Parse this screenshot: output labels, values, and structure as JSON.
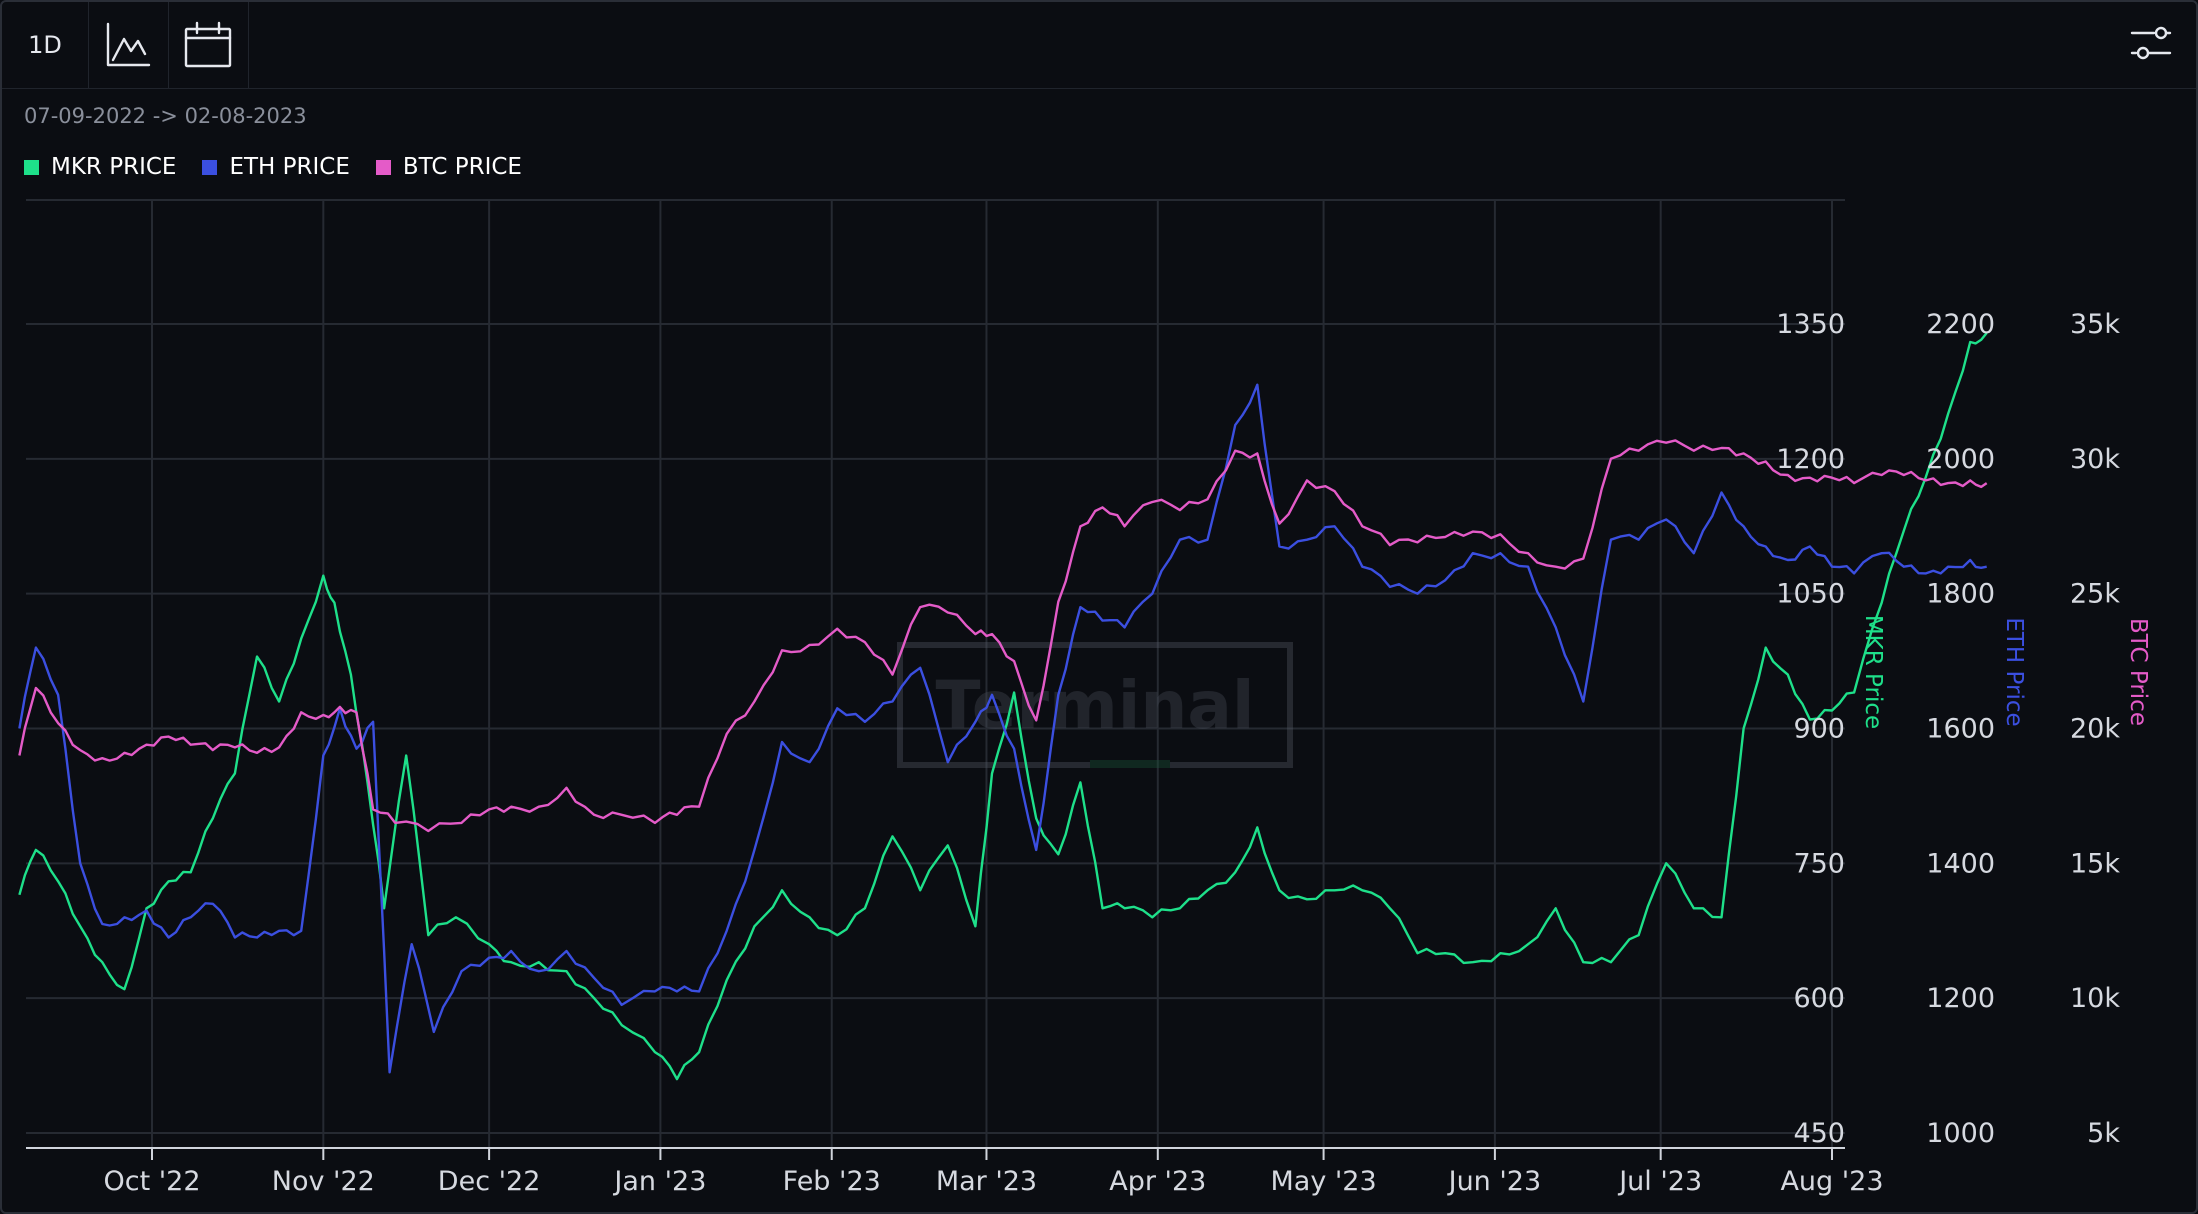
{
  "toolbar": {
    "interval_label": "1D",
    "chart_icon": "line-chart-icon",
    "calendar_icon": "calendar-icon",
    "settings_icon": "sliders-icon"
  },
  "date_range": "07-09-2022 -> 02-08-2023",
  "watermark": "Terminal",
  "legend": [
    {
      "label": "MKR PRICE",
      "color": "#1ee08a"
    },
    {
      "label": "ETH PRICE",
      "color": "#3b4fe0"
    },
    {
      "label": "BTC PRICE",
      "color": "#e45bc8"
    }
  ],
  "chart_data": {
    "type": "line",
    "x_tick_labels": [
      "Oct '22",
      "Nov '22",
      "Dec '22",
      "Jan '23",
      "Feb '23",
      "Mar '23",
      "Apr '23",
      "May '23",
      "Jun '23",
      "Jul '23",
      "Aug '23"
    ],
    "x_range": [
      "2022-09-07",
      "2023-08-02"
    ],
    "grid": true,
    "axes": [
      {
        "name": "MKR Price",
        "ticks": [
          "450",
          "600",
          "750",
          "900",
          "1050",
          "1200",
          "1350"
        ],
        "ylim": [
          450,
          1350
        ],
        "color": "#1ee08a"
      },
      {
        "name": "ETH Price",
        "ticks": [
          "1000",
          "1200",
          "1400",
          "1600",
          "1800",
          "2000",
          "2200"
        ],
        "ylim": [
          1000,
          2200
        ],
        "color": "#3b4fe0"
      },
      {
        "name": "BTC Price",
        "ticks": [
          "5k",
          "10k",
          "15k",
          "20k",
          "25k",
          "30k",
          "35k"
        ],
        "ylim": [
          5000,
          35000
        ],
        "color": "#e45bc8"
      }
    ],
    "series": [
      {
        "name": "MKR PRICE",
        "color": "#1ee08a",
        "axis": 0,
        "points": [
          [
            "2022-09-07",
            715
          ],
          [
            "2022-09-10",
            765
          ],
          [
            "2022-09-14",
            730
          ],
          [
            "2022-09-18",
            680
          ],
          [
            "2022-09-22",
            640
          ],
          [
            "2022-09-26",
            610
          ],
          [
            "2022-09-30",
            700
          ],
          [
            "2022-10-04",
            730
          ],
          [
            "2022-10-08",
            740
          ],
          [
            "2022-10-12",
            800
          ],
          [
            "2022-10-16",
            850
          ],
          [
            "2022-10-20",
            980
          ],
          [
            "2022-10-24",
            930
          ],
          [
            "2022-10-28",
            1000
          ],
          [
            "2022-11-01",
            1070
          ],
          [
            "2022-11-03",
            1040
          ],
          [
            "2022-11-06",
            960
          ],
          [
            "2022-11-09",
            840
          ],
          [
            "2022-11-12",
            700
          ],
          [
            "2022-11-16",
            870
          ],
          [
            "2022-11-20",
            670
          ],
          [
            "2022-11-25",
            690
          ],
          [
            "2022-12-01",
            660
          ],
          [
            "2022-12-05",
            640
          ],
          [
            "2022-12-10",
            640
          ],
          [
            "2022-12-15",
            630
          ],
          [
            "2022-12-20",
            600
          ],
          [
            "2022-12-25",
            570
          ],
          [
            "2022-12-31",
            540
          ],
          [
            "2023-01-04",
            510
          ],
          [
            "2023-01-08",
            540
          ],
          [
            "2023-01-13",
            620
          ],
          [
            "2023-01-18",
            680
          ],
          [
            "2023-01-23",
            720
          ],
          [
            "2023-01-28",
            690
          ],
          [
            "2023-02-02",
            670
          ],
          [
            "2023-02-07",
            700
          ],
          [
            "2023-02-12",
            780
          ],
          [
            "2023-02-17",
            720
          ],
          [
            "2023-02-22",
            770
          ],
          [
            "2023-02-27",
            680
          ],
          [
            "2023-03-02",
            850
          ],
          [
            "2023-03-06",
            940
          ],
          [
            "2023-03-10",
            800
          ],
          [
            "2023-03-14",
            760
          ],
          [
            "2023-03-18",
            840
          ],
          [
            "2023-03-22",
            700
          ],
          [
            "2023-03-26",
            700
          ],
          [
            "2023-03-31",
            690
          ],
          [
            "2023-04-05",
            700
          ],
          [
            "2023-04-10",
            720
          ],
          [
            "2023-04-15",
            740
          ],
          [
            "2023-04-19",
            790
          ],
          [
            "2023-04-23",
            720
          ],
          [
            "2023-04-28",
            710
          ],
          [
            "2023-05-03",
            720
          ],
          [
            "2023-05-08",
            720
          ],
          [
            "2023-05-13",
            700
          ],
          [
            "2023-05-18",
            650
          ],
          [
            "2023-05-23",
            650
          ],
          [
            "2023-05-28",
            640
          ],
          [
            "2023-06-02",
            650
          ],
          [
            "2023-06-07",
            660
          ],
          [
            "2023-06-12",
            700
          ],
          [
            "2023-06-17",
            640
          ],
          [
            "2023-06-22",
            640
          ],
          [
            "2023-06-27",
            670
          ],
          [
            "2023-07-02",
            750
          ],
          [
            "2023-07-07",
            700
          ],
          [
            "2023-07-12",
            690
          ],
          [
            "2023-07-16",
            900
          ],
          [
            "2023-07-20",
            990
          ],
          [
            "2023-07-24",
            960
          ],
          [
            "2023-07-28",
            910
          ],
          [
            "2023-08-01",
            920
          ],
          [
            "2023-08-05",
            940
          ],
          [
            "2023-08-10",
            1040
          ],
          [
            "2023-08-14",
            1120
          ],
          [
            "2023-08-18",
            1180
          ],
          [
            "2023-08-22",
            1250
          ],
          [
            "2023-08-26",
            1330
          ],
          [
            "2023-08-29",
            1340
          ]
        ]
      },
      {
        "name": "ETH PRICE",
        "color": "#3b4fe0",
        "axis": 1,
        "points": [
          [
            "2022-09-07",
            1600
          ],
          [
            "2022-09-10",
            1720
          ],
          [
            "2022-09-14",
            1650
          ],
          [
            "2022-09-18",
            1400
          ],
          [
            "2022-09-22",
            1310
          ],
          [
            "2022-09-26",
            1320
          ],
          [
            "2022-09-30",
            1330
          ],
          [
            "2022-10-04",
            1290
          ],
          [
            "2022-10-08",
            1320
          ],
          [
            "2022-10-12",
            1340
          ],
          [
            "2022-10-16",
            1290
          ],
          [
            "2022-10-20",
            1290
          ],
          [
            "2022-10-24",
            1300
          ],
          [
            "2022-10-28",
            1300
          ],
          [
            "2022-11-01",
            1560
          ],
          [
            "2022-11-04",
            1630
          ],
          [
            "2022-11-07",
            1570
          ],
          [
            "2022-11-10",
            1610
          ],
          [
            "2022-11-13",
            1090
          ],
          [
            "2022-11-17",
            1280
          ],
          [
            "2022-11-21",
            1150
          ],
          [
            "2022-11-26",
            1240
          ],
          [
            "2022-12-01",
            1260
          ],
          [
            "2022-12-05",
            1270
          ],
          [
            "2022-12-10",
            1240
          ],
          [
            "2022-12-15",
            1270
          ],
          [
            "2022-12-20",
            1230
          ],
          [
            "2022-12-25",
            1190
          ],
          [
            "2022-12-31",
            1210
          ],
          [
            "2023-01-04",
            1210
          ],
          [
            "2023-01-08",
            1210
          ],
          [
            "2023-01-13",
            1300
          ],
          [
            "2023-01-18",
            1420
          ],
          [
            "2023-01-23",
            1580
          ],
          [
            "2023-01-28",
            1550
          ],
          [
            "2023-02-02",
            1630
          ],
          [
            "2023-02-07",
            1610
          ],
          [
            "2023-02-12",
            1640
          ],
          [
            "2023-02-17",
            1690
          ],
          [
            "2023-02-22",
            1550
          ],
          [
            "2023-02-27",
            1610
          ],
          [
            "2023-03-02",
            1650
          ],
          [
            "2023-03-06",
            1570
          ],
          [
            "2023-03-10",
            1420
          ],
          [
            "2023-03-14",
            1650
          ],
          [
            "2023-03-18",
            1780
          ],
          [
            "2023-03-22",
            1760
          ],
          [
            "2023-03-26",
            1750
          ],
          [
            "2023-03-31",
            1800
          ],
          [
            "2023-04-05",
            1880
          ],
          [
            "2023-04-10",
            1880
          ],
          [
            "2023-04-15",
            2050
          ],
          [
            "2023-04-19",
            2110
          ],
          [
            "2023-04-23",
            1870
          ],
          [
            "2023-04-28",
            1880
          ],
          [
            "2023-05-03",
            1900
          ],
          [
            "2023-05-08",
            1840
          ],
          [
            "2023-05-13",
            1810
          ],
          [
            "2023-05-18",
            1800
          ],
          [
            "2023-05-23",
            1820
          ],
          [
            "2023-05-28",
            1860
          ],
          [
            "2023-06-02",
            1860
          ],
          [
            "2023-06-07",
            1840
          ],
          [
            "2023-06-12",
            1750
          ],
          [
            "2023-06-17",
            1640
          ],
          [
            "2023-06-22",
            1880
          ],
          [
            "2023-06-27",
            1880
          ],
          [
            "2023-07-02",
            1910
          ],
          [
            "2023-07-07",
            1860
          ],
          [
            "2023-07-12",
            1950
          ],
          [
            "2023-07-16",
            1900
          ],
          [
            "2023-07-20",
            1870
          ],
          [
            "2023-07-24",
            1850
          ],
          [
            "2023-07-28",
            1870
          ],
          [
            "2023-08-01",
            1840
          ],
          [
            "2023-08-05",
            1830
          ],
          [
            "2023-08-10",
            1860
          ],
          [
            "2023-08-14",
            1840
          ],
          [
            "2023-08-18",
            1830
          ],
          [
            "2023-08-22",
            1840
          ],
          [
            "2023-08-26",
            1850
          ],
          [
            "2023-08-29",
            1840
          ]
        ]
      },
      {
        "name": "BTC PRICE",
        "color": "#e45bc8",
        "axis": 2,
        "points": [
          [
            "2022-09-07",
            19000
          ],
          [
            "2022-09-10",
            21500
          ],
          [
            "2022-09-14",
            20200
          ],
          [
            "2022-09-18",
            19200
          ],
          [
            "2022-09-22",
            18900
          ],
          [
            "2022-09-26",
            19100
          ],
          [
            "2022-09-30",
            19400
          ],
          [
            "2022-10-04",
            19700
          ],
          [
            "2022-10-08",
            19400
          ],
          [
            "2022-10-12",
            19200
          ],
          [
            "2022-10-16",
            19300
          ],
          [
            "2022-10-20",
            19100
          ],
          [
            "2022-10-24",
            19300
          ],
          [
            "2022-10-28",
            20600
          ],
          [
            "2022-11-01",
            20500
          ],
          [
            "2022-11-04",
            20800
          ],
          [
            "2022-11-07",
            20600
          ],
          [
            "2022-11-10",
            17000
          ],
          [
            "2022-11-14",
            16500
          ],
          [
            "2022-11-20",
            16200
          ],
          [
            "2022-11-26",
            16500
          ],
          [
            "2022-12-01",
            17000
          ],
          [
            "2022-12-05",
            17100
          ],
          [
            "2022-12-10",
            17100
          ],
          [
            "2022-12-15",
            17800
          ],
          [
            "2022-12-20",
            16800
          ],
          [
            "2022-12-25",
            16800
          ],
          [
            "2022-12-31",
            16500
          ],
          [
            "2023-01-04",
            16800
          ],
          [
            "2023-01-08",
            17100
          ],
          [
            "2023-01-13",
            19800
          ],
          [
            "2023-01-18",
            21000
          ],
          [
            "2023-01-23",
            22900
          ],
          [
            "2023-01-28",
            23100
          ],
          [
            "2023-02-02",
            23700
          ],
          [
            "2023-02-07",
            23200
          ],
          [
            "2023-02-12",
            22000
          ],
          [
            "2023-02-17",
            24500
          ],
          [
            "2023-02-22",
            24300
          ],
          [
            "2023-02-27",
            23500
          ],
          [
            "2023-03-02",
            23500
          ],
          [
            "2023-03-06",
            22500
          ],
          [
            "2023-03-10",
            20300
          ],
          [
            "2023-03-14",
            24700
          ],
          [
            "2023-03-18",
            27500
          ],
          [
            "2023-03-22",
            28200
          ],
          [
            "2023-03-26",
            27500
          ],
          [
            "2023-03-31",
            28400
          ],
          [
            "2023-04-05",
            28100
          ],
          [
            "2023-04-10",
            28500
          ],
          [
            "2023-04-15",
            30300
          ],
          [
            "2023-04-19",
            30200
          ],
          [
            "2023-04-23",
            27600
          ],
          [
            "2023-04-28",
            29200
          ],
          [
            "2023-05-03",
            28800
          ],
          [
            "2023-05-08",
            27500
          ],
          [
            "2023-05-13",
            26800
          ],
          [
            "2023-05-18",
            26900
          ],
          [
            "2023-05-23",
            27100
          ],
          [
            "2023-05-28",
            27300
          ],
          [
            "2023-06-02",
            27200
          ],
          [
            "2023-06-07",
            26500
          ],
          [
            "2023-06-12",
            26000
          ],
          [
            "2023-06-17",
            26300
          ],
          [
            "2023-06-22",
            30000
          ],
          [
            "2023-06-27",
            30300
          ],
          [
            "2023-07-02",
            30600
          ],
          [
            "2023-07-07",
            30300
          ],
          [
            "2023-07-12",
            30400
          ],
          [
            "2023-07-16",
            30200
          ],
          [
            "2023-07-20",
            29900
          ],
          [
            "2023-07-24",
            29400
          ],
          [
            "2023-07-28",
            29300
          ],
          [
            "2023-08-01",
            29300
          ],
          [
            "2023-08-05",
            29100
          ],
          [
            "2023-08-10",
            29400
          ],
          [
            "2023-08-14",
            29400
          ],
          [
            "2023-08-18",
            29200
          ],
          [
            "2023-08-22",
            29100
          ],
          [
            "2023-08-26",
            29200
          ],
          [
            "2023-08-29",
            29100
          ]
        ]
      }
    ]
  }
}
